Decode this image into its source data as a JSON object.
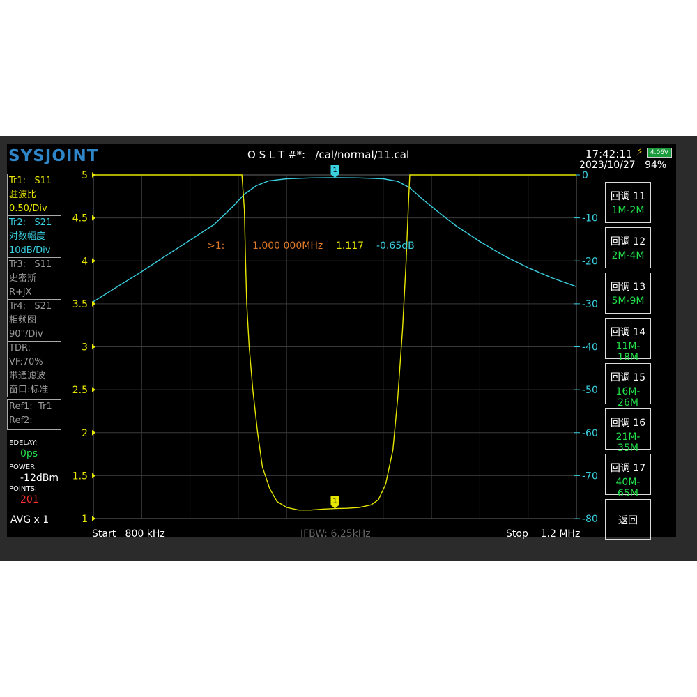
{
  "header": {
    "logo": "SYSJOINT",
    "cal_file": "O S L T #*:   /cal/normal/11.cal",
    "time": "17:42:11",
    "date": "2023/10/27",
    "battery_voltage": "4.06V",
    "battery_percent": "94%"
  },
  "traces": [
    {
      "lines": [
        "Tr1:   S11",
        "驻波比",
        "0.50/Div"
      ],
      "color": "#e6e600"
    },
    {
      "lines": [
        "Tr2:   S21",
        "对数幅度",
        "10dB/Div"
      ],
      "color": "#3ad0e0"
    },
    {
      "lines": [
        "Tr3:   S11",
        "史密斯",
        "R+jX"
      ],
      "color": "#9a9a9a"
    },
    {
      "lines": [
        "Tr4:   S21",
        "相频图",
        "90°/Div"
      ],
      "color": "#9a9a9a"
    },
    {
      "lines": [
        "TDR:",
        "VF:70%",
        "带通滤波",
        "窗口:标准"
      ],
      "color": "#9a9a9a"
    },
    {
      "lines": [
        "Ref1:  Tr1",
        "Ref2:"
      ],
      "color": "#9a9a9a"
    }
  ],
  "status": {
    "edelay_label": "EDELAY:",
    "edelay_value": "0ps",
    "power_label": "POWER:",
    "power_value": "-12dBm",
    "points_label": "POINTS:",
    "points_value": "201",
    "avg": "AVG x 1"
  },
  "menu": [
    {
      "title": "回调 11",
      "range": "1M-2M"
    },
    {
      "title": "回调 12",
      "range": "2M-4M"
    },
    {
      "title": "回调 13",
      "range": "5M-9M"
    },
    {
      "title": "回调 14",
      "range": "11M-18M"
    },
    {
      "title": "回调 15",
      "range": "16M-26M"
    },
    {
      "title": "回调 16",
      "range": "21M-35M"
    },
    {
      "title": "回调 17",
      "range": "40M-65M"
    }
  ],
  "back_label": "返回",
  "chart_data": {
    "type": "line",
    "start_label": "Start   800 kHz",
    "stop_label": "Stop    1.2 MHz",
    "ifbw_label": "IFBW: 6.25kHz",
    "x_range_mhz": [
      0.8,
      1.2
    ],
    "grid": true,
    "left_axis": {
      "ylim": [
        1,
        5
      ],
      "ticks": [
        "5",
        "4.5",
        "4",
        "3.5",
        "3",
        "2.5",
        "2",
        "1.5",
        "1"
      ],
      "color": "#e6e600"
    },
    "right_axis": {
      "ylim": [
        -80,
        0
      ],
      "ticks": [
        "0",
        "-10",
        "-20",
        "-30",
        "-40",
        "-50",
        "-60",
        "-70",
        "-80"
      ],
      "color": "#3ad0e0"
    },
    "series": [
      {
        "trace": "Tr1",
        "axis": "left",
        "color": "#e6e600",
        "points": [
          [
            0.8,
            5
          ],
          [
            0.923,
            5
          ],
          [
            0.925,
            4.6
          ],
          [
            0.926,
            4.0
          ],
          [
            0.927,
            3.5
          ],
          [
            0.929,
            3.0
          ],
          [
            0.932,
            2.5
          ],
          [
            0.936,
            2.0
          ],
          [
            0.94,
            1.6
          ],
          [
            0.946,
            1.35
          ],
          [
            0.952,
            1.2
          ],
          [
            0.96,
            1.13
          ],
          [
            0.97,
            1.1
          ],
          [
            0.98,
            1.1
          ],
          [
            0.99,
            1.11
          ],
          [
            1.0,
            1.117
          ],
          [
            1.01,
            1.12
          ],
          [
            1.02,
            1.13
          ],
          [
            1.03,
            1.16
          ],
          [
            1.036,
            1.22
          ],
          [
            1.042,
            1.4
          ],
          [
            1.048,
            1.8
          ],
          [
            1.052,
            2.4
          ],
          [
            1.056,
            3.2
          ],
          [
            1.059,
            4.0
          ],
          [
            1.061,
            4.7
          ],
          [
            1.062,
            5
          ],
          [
            1.2,
            5
          ]
        ]
      },
      {
        "trace": "Tr2",
        "axis": "right",
        "color": "#3ad0e0",
        "points": [
          [
            0.8,
            -29.5
          ],
          [
            0.82,
            -26
          ],
          [
            0.84,
            -22.5
          ],
          [
            0.86,
            -18.8
          ],
          [
            0.88,
            -15.2
          ],
          [
            0.9,
            -11.5
          ],
          [
            0.915,
            -7.5
          ],
          [
            0.925,
            -4.5
          ],
          [
            0.935,
            -2.5
          ],
          [
            0.945,
            -1.4
          ],
          [
            0.96,
            -0.9
          ],
          [
            0.98,
            -0.7
          ],
          [
            1.0,
            -0.65
          ],
          [
            1.02,
            -0.7
          ],
          [
            1.04,
            -0.9
          ],
          [
            1.052,
            -1.5
          ],
          [
            1.062,
            -3.0
          ],
          [
            1.072,
            -5.5
          ],
          [
            1.085,
            -8.5
          ],
          [
            1.1,
            -11.8
          ],
          [
            1.12,
            -15.5
          ],
          [
            1.14,
            -18.8
          ],
          [
            1.16,
            -21.6
          ],
          [
            1.18,
            -24
          ],
          [
            1.2,
            -26
          ]
        ]
      }
    ],
    "marker": {
      "id": "1",
      "label": ">1:",
      "frequency": "1.000 000MHz",
      "swr": "1.117",
      "s21": "-0.65dB",
      "x": 1.0,
      "swr_value": 1.117,
      "s21_value": -0.65
    }
  }
}
